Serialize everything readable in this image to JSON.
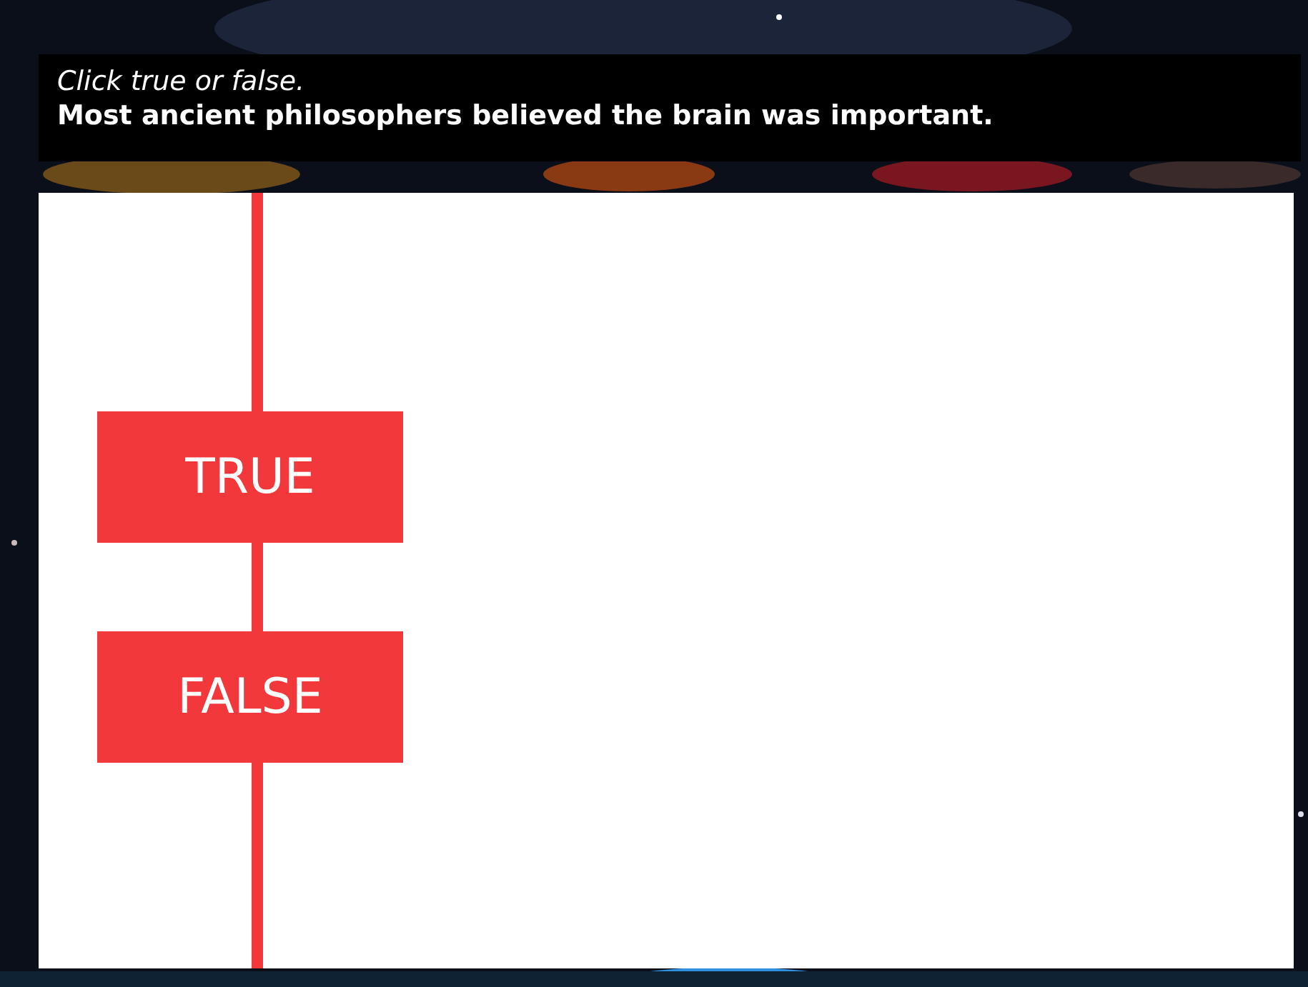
{
  "prompt": {
    "instruction": "Click true or false.",
    "statement": "Most ancient philosophers believed the brain was important."
  },
  "answers": [
    {
      "label": "TRUE"
    },
    {
      "label": "FALSE"
    }
  ]
}
